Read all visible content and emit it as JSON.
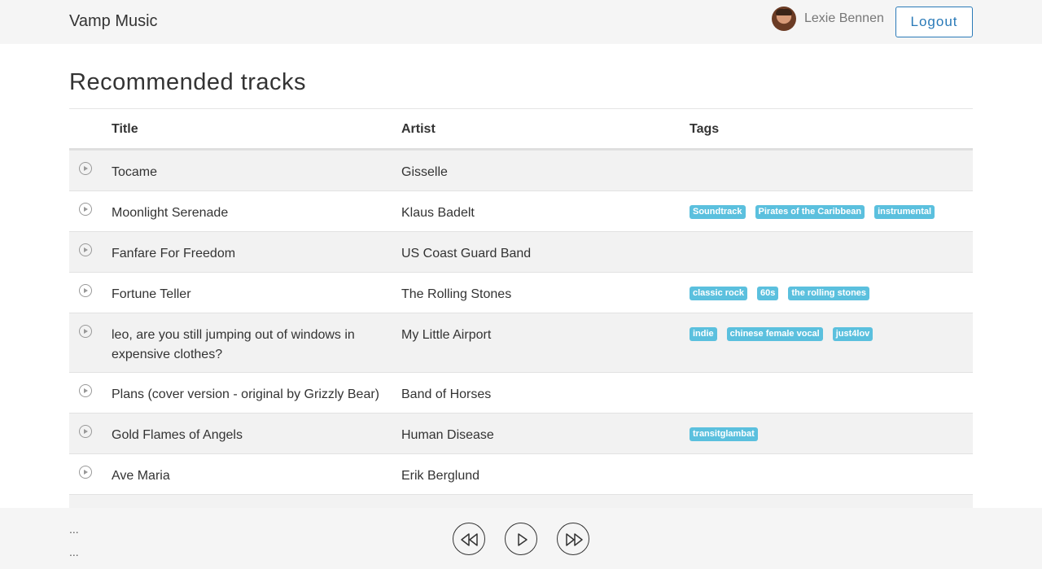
{
  "header": {
    "brand": "Vamp Music",
    "user_name": "Lexie Bennen",
    "logout_label": "Logout"
  },
  "page": {
    "title": "Recommended tracks"
  },
  "table": {
    "columns": {
      "title": "Title",
      "artist": "Artist",
      "tags": "Tags"
    },
    "rows": [
      {
        "title": "Tocame",
        "artist": "Gisselle",
        "tags": []
      },
      {
        "title": "Moonlight Serenade",
        "artist": "Klaus Badelt",
        "tags": [
          "Soundtrack",
          "Pirates of the Caribbean",
          "instrumental"
        ]
      },
      {
        "title": "Fanfare For Freedom",
        "artist": "US Coast Guard Band",
        "tags": []
      },
      {
        "title": "Fortune Teller",
        "artist": "The Rolling Stones",
        "tags": [
          "classic rock",
          "60s",
          "the rolling stones"
        ]
      },
      {
        "title": "leo, are you still jumping out of windows in expensive clothes?",
        "artist": "My Little Airport",
        "tags": [
          "indie",
          "chinese female vocal",
          "just4lov"
        ]
      },
      {
        "title": "Plans (cover version - original by Grizzly Bear)",
        "artist": "Band of Horses",
        "tags": []
      },
      {
        "title": "Gold Flames of Angels",
        "artist": "Human Disease",
        "tags": [
          "transitglambat"
        ]
      },
      {
        "title": "Ave Maria",
        "artist": "Erik Berglund",
        "tags": []
      }
    ]
  },
  "player": {
    "now_title": "...",
    "now_artist": "...",
    "icons": {
      "previous": "rewind-icon",
      "play": "play-icon",
      "next": "fast-forward-icon"
    }
  },
  "colors": {
    "accent": "#2a7ab8",
    "tag_bg": "#5bc0de",
    "navbar_bg": "#f5f5f5",
    "row_stripe": "#f2f2f2"
  }
}
